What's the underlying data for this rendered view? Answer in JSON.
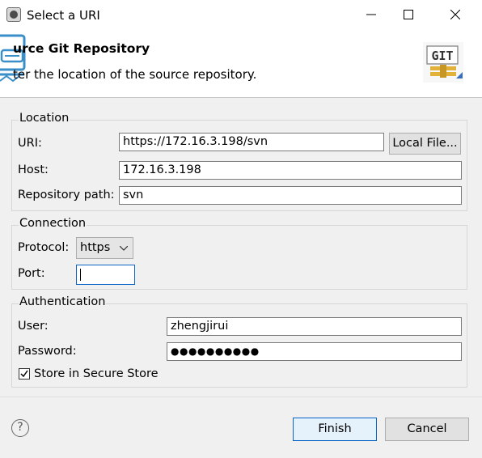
{
  "window": {
    "title": "Select a URI",
    "minimize_glyph": "—",
    "maximize_glyph": "☐",
    "close_glyph": "✕"
  },
  "header": {
    "title": "urce Git Repository",
    "description": "ter the location of the source repository.",
    "badge_text": "GIT"
  },
  "location": {
    "legend": "Location",
    "uri_label": "URI:",
    "uri_value": "https://172.16.3.198/svn",
    "local_file_button": "Local File...",
    "host_label": "Host:",
    "host_value": "172.16.3.198",
    "repo_path_label": "Repository path:",
    "repo_path_value": "svn"
  },
  "connection": {
    "legend": "Connection",
    "protocol_label": "Protocol:",
    "protocol_value": "https",
    "port_label": "Port:",
    "port_value": ""
  },
  "authentication": {
    "legend": "Authentication",
    "user_label": "User:",
    "user_value": "zhengjirui",
    "password_label": "Password:",
    "password_masked": "●●●●●●●●●●",
    "store_label": "Store in Secure Store",
    "store_checked": true
  },
  "footer": {
    "help_glyph": "?",
    "finish_button": "Finish",
    "cancel_button": "Cancel"
  },
  "icons": {
    "app": "eclipse-icon",
    "header": "git-clone-icon",
    "badge": "git-badge-icon",
    "help": "help-icon",
    "dropdown": "chevron-down-icon",
    "checkbox": "checkmark-icon"
  }
}
